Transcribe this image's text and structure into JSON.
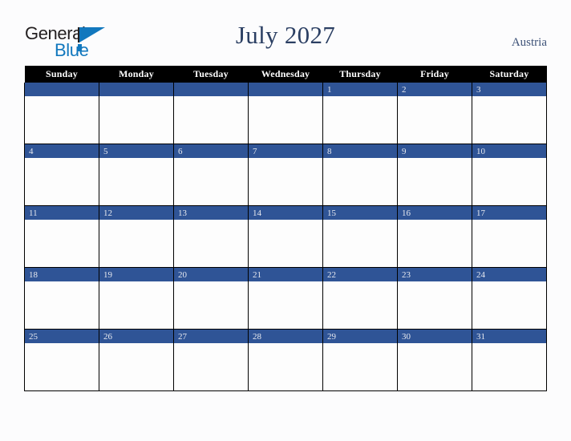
{
  "brand": {
    "name_part1": "General",
    "name_part2": "Blue",
    "accent_color": "#1278be",
    "text_color": "#231f20"
  },
  "header": {
    "title": "July 2027",
    "country": "Austria",
    "title_color": "#2b3f63",
    "country_color": "#3d5278"
  },
  "calendar": {
    "month": "July",
    "year": "2027",
    "weekday_headers": [
      "Sunday",
      "Monday",
      "Tuesday",
      "Wednesday",
      "Thursday",
      "Friday",
      "Saturday"
    ],
    "header_bg": "#000000",
    "header_text": "#ffffff",
    "date_bar_color": "#2f5496",
    "date_text_color": "#e8eaf0",
    "cell_bg": "#fdfdfd",
    "grid_line_color": "#000000",
    "weeks": [
      [
        "",
        "",
        "",
        "",
        "1",
        "2",
        "3"
      ],
      [
        "4",
        "5",
        "6",
        "7",
        "8",
        "9",
        "10"
      ],
      [
        "11",
        "12",
        "13",
        "14",
        "15",
        "16",
        "17"
      ],
      [
        "18",
        "19",
        "20",
        "21",
        "22",
        "23",
        "24"
      ],
      [
        "25",
        "26",
        "27",
        "28",
        "29",
        "30",
        "31"
      ]
    ]
  }
}
